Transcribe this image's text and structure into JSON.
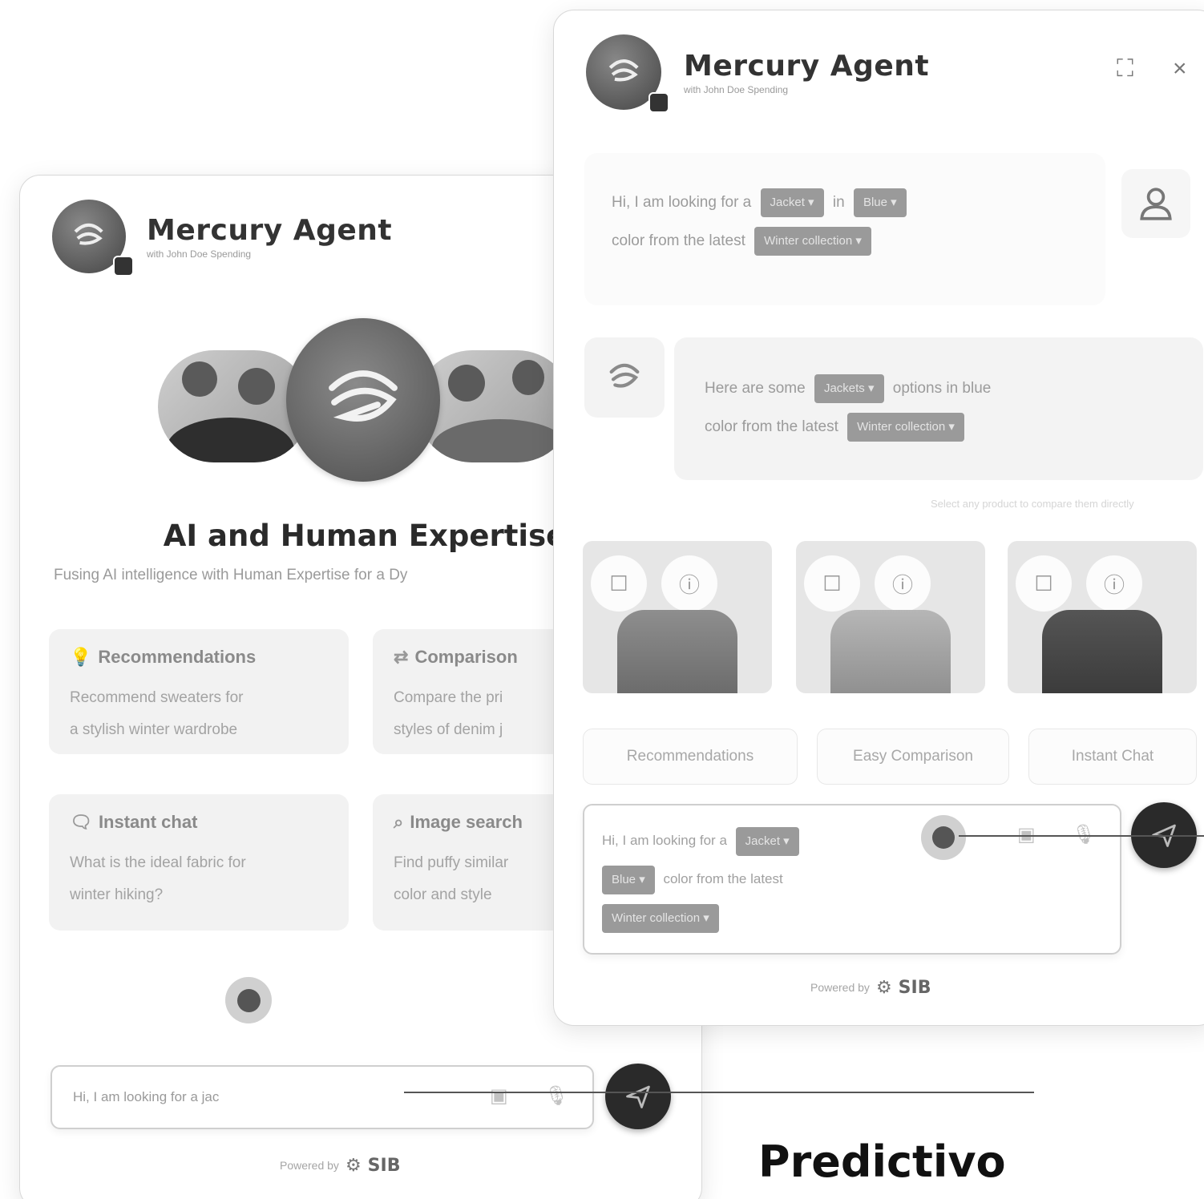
{
  "left_panel": {
    "header": {
      "title": "Mercury Agent",
      "subtitle": "with John Doe Spending"
    },
    "headline": "AI and Human Expertise",
    "tagline": "Fusing AI intelligence with Human Expertise for a Dy",
    "cards": [
      {
        "icon": "lightbulb-icon",
        "title": "Recommendations",
        "line1": "Recommend sweaters for",
        "line2": "a stylish winter wardrobe"
      },
      {
        "icon": "compare-icon",
        "title": "Comparison",
        "line1": "Compare the pri",
        "line2": "styles of denim j"
      },
      {
        "icon": "chat-icon",
        "title": "Instant chat",
        "line1": "What is the ideal fabric for",
        "line2": "winter hiking?"
      },
      {
        "icon": "image-search-icon",
        "title": "Image search",
        "line1": "Find puffy similar",
        "line2": "color and style"
      }
    ],
    "input": {
      "text": "Hi, I am looking for a jac"
    },
    "powered_by": "Powered by",
    "brand": "SIB"
  },
  "right_panel": {
    "header": {
      "title": "Mercury Agent",
      "subtitle": "with John Doe Spending"
    },
    "user_message": {
      "part1": "Hi, I am looking for a",
      "chip1": "Jacket ▾",
      "part2": "in",
      "chip2": "Blue ▾",
      "part3": "color from the latest",
      "chip3": "Winter collection ▾"
    },
    "bot_message": {
      "part1": "Here are some",
      "chip1": "Jackets ▾",
      "part2": "options in blue",
      "part3": "color from the latest",
      "chip2": "Winter collection ▾"
    },
    "note": "Select any product to compare them directly",
    "suggestions": [
      "Recommendations",
      "Easy Comparison",
      "Instant Chat"
    ],
    "input": {
      "part1": "Hi, I am looking for a",
      "chip1": "Jacket ▾",
      "chip2": "Blue ▾",
      "part2": "color from the latest",
      "chip3": "Winter collection ▾"
    },
    "powered_by": "Powered by",
    "brand": "SIB"
  },
  "caption": "Predictivo",
  "colors": {
    "send_button": "#2a2a2a",
    "chip": "#9a9a9a",
    "card": "#f2f2f2"
  }
}
